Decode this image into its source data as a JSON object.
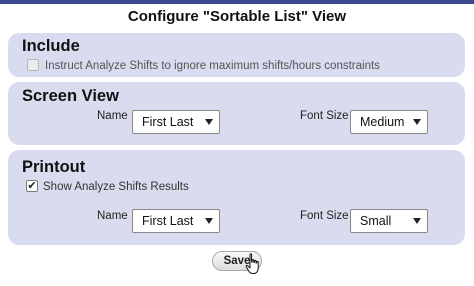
{
  "dialog": {
    "title": "Configure \"Sortable List\" View"
  },
  "include": {
    "heading": "Include",
    "ignore_constraints": {
      "label": "Instruct Analyze Shifts to ignore maximum shifts/hours constraints",
      "checked": false
    }
  },
  "screen_view": {
    "heading": "Screen View",
    "name_label": "Name",
    "name_value": "First Last",
    "font_size_label": "Font Size",
    "font_size_value": "Medium"
  },
  "printout": {
    "heading": "Printout",
    "show_results": {
      "label": "Show Analyze Shifts Results",
      "checked": true
    },
    "name_label": "Name",
    "name_value": "First Last",
    "font_size_label": "Font Size",
    "font_size_value": "Small"
  },
  "actions": {
    "save_label": "Save"
  },
  "colors": {
    "accent": "#3b4a8c",
    "panel_bg": "#d9dcee"
  },
  "icons": {
    "cursor": "hand-pointer-icon",
    "dropdown": "chevron-down-icon"
  }
}
